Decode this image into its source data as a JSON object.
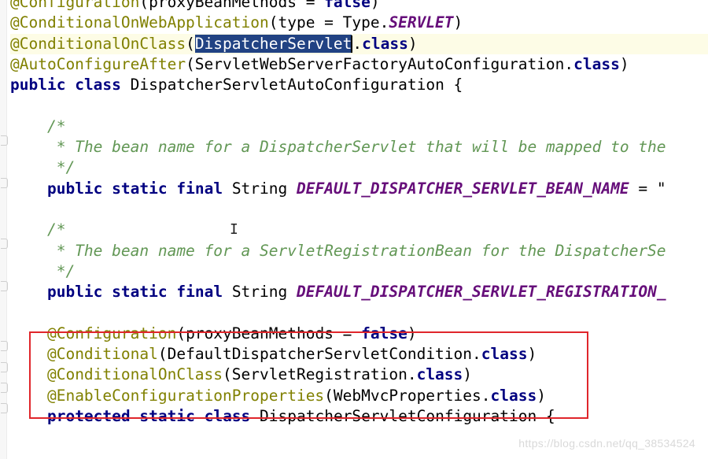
{
  "lines": {
    "l0": {
      "ann": "@Configuration",
      "p1": "(proxyBeanMethods = ",
      "kw": "false",
      "p2": ")"
    },
    "l1": {
      "ann": "@ConditionalOnWebApplication",
      "p1": "(type = Type.",
      "enum": "SERVLET",
      "p2": ")"
    },
    "l2": {
      "ann": "@ConditionalOnClass",
      "p1": "(",
      "sel": "DispatcherServlet",
      ".p2": ".",
      "kw": "class",
      "p2": ")",
      "dot": "."
    },
    "l3": {
      "ann": "@AutoConfigureAfter",
      "p1": "(ServletWebServerFactoryAutoConfiguration.",
      "kw": "class",
      "p2": ")"
    },
    "l4": {
      "kw1": "public",
      "kw2": "class",
      "p1": " DispatcherServletAutoConfiguration {"
    },
    "l6": {
      "c": "    /*"
    },
    "l7": {
      "c": "     * The bean name for a DispatcherServlet that will be mapped to the"
    },
    "l8": {
      "c": "     */"
    },
    "l9": {
      "kw1": "public",
      "kw2": "static",
      "kw3": "final",
      "t": " String ",
      "const": "DEFAULT_DISPATCHER_SERVLET_BEAN_NAME",
      "t2": " = \""
    },
    "l11": {
      "c": "    /*"
    },
    "l12": {
      "c": "     * The bean name for a ServletRegistrationBean for the DispatcherSe"
    },
    "l13": {
      "c": "     */"
    },
    "l14": {
      "kw1": "public",
      "kw2": "static",
      "kw3": "final",
      "t": " String ",
      "const": "DEFAULT_DISPATCHER_SERVLET_REGISTRATION_"
    },
    "l16": {
      "ann": "@Configuration",
      "p1": "(proxyBeanMethods = ",
      "kw": "false",
      "p2": ")"
    },
    "l17": {
      "ann": "@Conditional",
      "p1": "(DefaultDispatcherServletCondition.",
      "kw": "class",
      "p2": ")"
    },
    "l18": {
      "ann": "@ConditionalOnClass",
      "p1": "(ServletRegistration.",
      "kw": "class",
      "p2": ")"
    },
    "l19": {
      "ann": "@EnableConfigurationProperties",
      "p1": "(WebMvcProperties.",
      "kw": "class",
      "p2": ")"
    },
    "l20": {
      "kw1": "protected",
      "kw2": "static",
      "kw3": "class",
      "p1": " DispatcherServletConfiguration {"
    }
  },
  "watermark": "https://blog.csdn.net/qq_38534524",
  "colors": {
    "annotation": "#808000",
    "keyword": "#000080",
    "comment": "#629755",
    "constant": "#660e7a",
    "selection": "#214283",
    "highlight_box": "#e0262b",
    "current_line": "#fdfce6"
  }
}
